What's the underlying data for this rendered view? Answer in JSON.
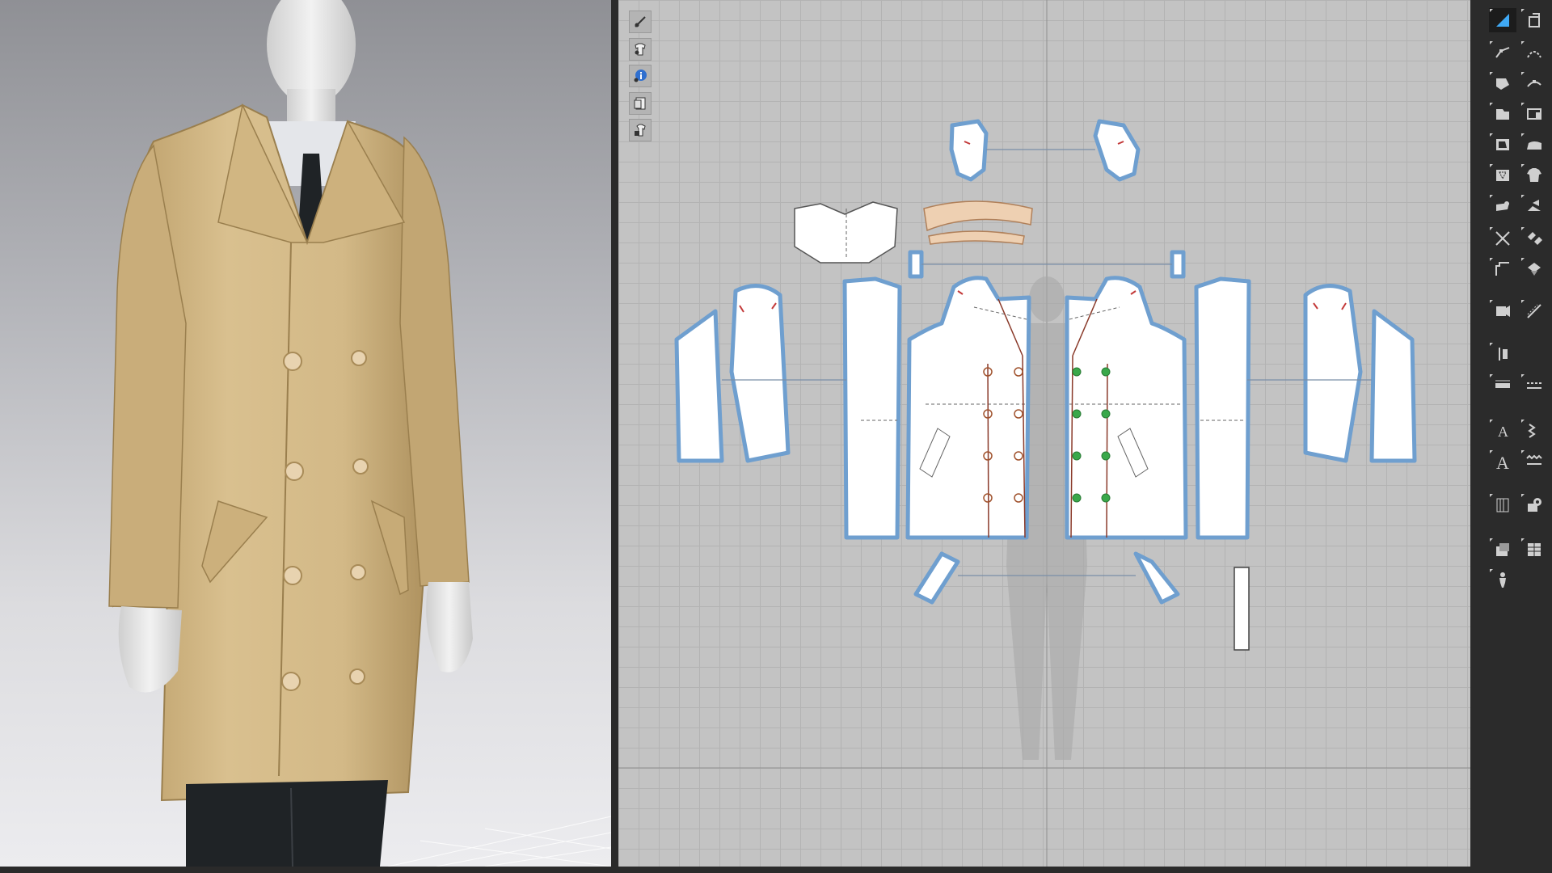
{
  "app": {
    "viewport_3d": {
      "label": ""
    },
    "pattern_window": {
      "label": ""
    }
  },
  "pattern_mini_toolbar": {
    "items": [
      {
        "icon": "needle-eye-icon"
      },
      {
        "icon": "garment-eye-icon"
      },
      {
        "icon": "info-icon"
      },
      {
        "icon": "pattern-sheet-icon"
      },
      {
        "icon": "lock-garment-icon"
      }
    ]
  },
  "right_toolbar": {
    "items": [
      {
        "icon": "transform-pattern-icon",
        "active": true
      },
      {
        "icon": "transform-3d-icon"
      },
      {
        "icon": "edit-pattern-icon"
      },
      {
        "icon": "edit-curvature-icon"
      },
      {
        "icon": "add-point-icon"
      },
      {
        "icon": "curve-point-icon"
      },
      {
        "icon": "polygon-icon"
      },
      {
        "icon": "rectangle-icon"
      },
      {
        "icon": "internal-shape-icon"
      },
      {
        "icon": "iron-icon"
      },
      {
        "icon": "dart-icon"
      },
      {
        "icon": "shirt-icon"
      },
      {
        "icon": "fold-arrangement-icon"
      },
      {
        "icon": "segment-sewing-icon"
      },
      {
        "icon": "trace-icon"
      },
      {
        "icon": "free-sewing-icon"
      },
      {
        "icon": "puckering-icon"
      },
      {
        "icon": "tack-icon"
      },
      {
        "icon": "seam-allowance-icon"
      },
      {
        "icon": "ruler-icon"
      },
      {
        "icon": "binding-icon"
      },
      {
        "icon": "topstitch-icon"
      },
      {
        "icon": "text-icon"
      },
      {
        "icon": "zigzag-stitch-icon"
      },
      {
        "icon": "annotation-icon"
      },
      {
        "icon": "wave-stitch-icon"
      },
      {
        "icon": "grading-icon"
      },
      {
        "icon": "button-icon"
      },
      {
        "icon": "fabric-icon"
      },
      {
        "icon": "avatar-measure-icon"
      },
      {
        "icon": "avatar-pose-icon"
      }
    ]
  },
  "colors": {
    "workspace_bg": "#c3c3c3",
    "grid_line": "#b3b3b3",
    "pattern_fill": "#ffffff",
    "pattern_outline": "#6f9fcf",
    "sewing_line_red": "#c33a3a",
    "button_marker_green": "#3aa84a",
    "collar_fill": "#eed0b2",
    "coat_color": "#d7bd8d",
    "toolbar_bg": "#2b2b2b"
  }
}
